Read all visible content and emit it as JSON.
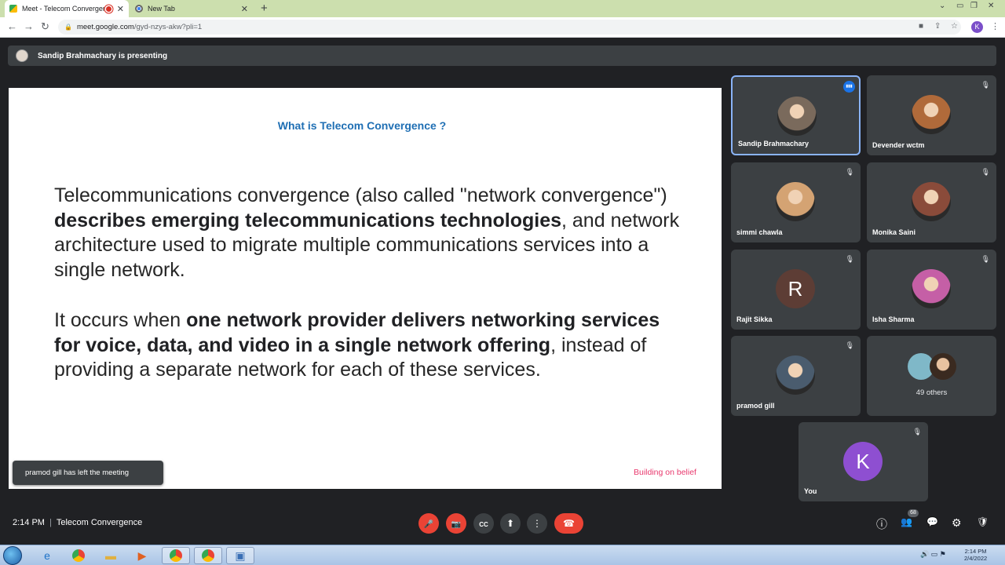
{
  "browser": {
    "tabs": [
      {
        "title": "Meet - Telecom Convergence",
        "recording": true
      },
      {
        "title": "New Tab",
        "recording": false
      }
    ],
    "new_tab_symbol": "+",
    "url_main": "meet.google.com",
    "url_rest": "/gyd-nzys-akw?pli=1",
    "profile_initial": "K"
  },
  "meet": {
    "presenting_text": "Sandip Brahmachary is presenting",
    "slide": {
      "title": "What is Telecom Convergence ?",
      "p1": {
        "a": "Telecommunications convergence (also called \"network convergence\") ",
        "b": "describes emerging telecommunications technologies",
        "c": ", and network architecture used to migrate multiple communications services into a single network."
      },
      "p2": {
        "a": "It occurs when ",
        "b": "one network provider delivers networking services for voice, data, and video in a single network offering",
        "c": ", instead of providing a separate network for each of these services."
      },
      "brand": "Building on belief"
    },
    "toast": "pramod gill has left the meeting",
    "participants": [
      {
        "name": "Sandip Brahmachary",
        "speaking": true,
        "avatar": "photo",
        "color": "#7a6a5c"
      },
      {
        "name": "Devender wctm",
        "speaking": false,
        "avatar": "photo",
        "color": "#b06a3a"
      },
      {
        "name": "simmi chawla",
        "speaking": false,
        "avatar": "photo",
        "color": "#d4a373"
      },
      {
        "name": "Monika Saini",
        "speaking": false,
        "avatar": "photo",
        "color": "#8a4b3a"
      },
      {
        "name": "Rajit Sikka",
        "speaking": false,
        "avatar": "letter",
        "letter": "R",
        "color": "#5d3d35"
      },
      {
        "name": "Isha Sharma",
        "speaking": false,
        "avatar": "photo",
        "color": "#c55fa6"
      },
      {
        "name": "pramod gill",
        "speaking": false,
        "avatar": "photo",
        "color": "#4a5c6e"
      }
    ],
    "others_text": "49 others",
    "self": {
      "name": "You",
      "letter": "K",
      "color": "#8e4fd1"
    },
    "time": "2:14 PM",
    "meeting_title": "Telecom Convergence",
    "people_count": "68"
  },
  "taskbar": {
    "time": "2:14 PM",
    "date": "2/4/2022"
  },
  "icons": {
    "mic_off": "🎤",
    "cam_off": "📷",
    "captions": "CC",
    "present": "⬆",
    "more": "⋮",
    "end_call": "☎",
    "info": "ⓘ",
    "people": "👥",
    "chat": "💬",
    "activities": "⚙",
    "host": "🛡"
  }
}
